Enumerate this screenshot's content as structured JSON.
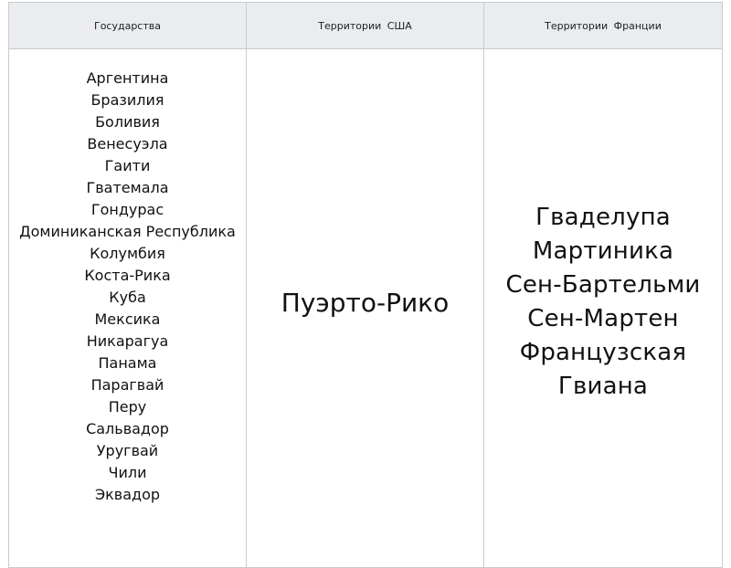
{
  "table": {
    "headers": [
      "Государства",
      "Территории  США",
      "Территории  Франции"
    ],
    "countries": [
      "Аргентина",
      "Бразилия",
      "Боливия",
      "Венесуэла",
      "Гаити",
      "Гватемала",
      "Гондурас",
      "Доминиканская Республика",
      "Колумбия",
      "Коста-Рика",
      "Куба",
      "Мексика",
      "Никарагуа",
      "Панама",
      "Парагвай",
      "Перу",
      "Сальвадор",
      "Уругвай",
      "Чили",
      "Эквадор"
    ],
    "us_territories": [
      "Пуэрто-Рико"
    ],
    "french_territories": [
      "Гваделупа",
      "Мартиника",
      "Сен-Бартельми",
      "Сен-Мартен",
      "Французская",
      "Гвиана"
    ]
  }
}
